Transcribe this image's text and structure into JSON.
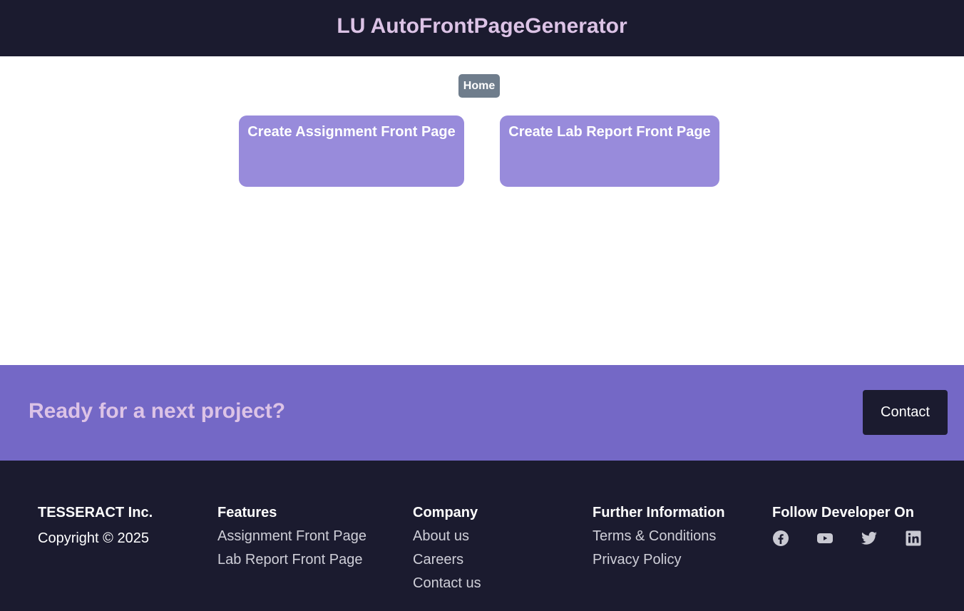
{
  "header": {
    "title": "LU AutoFrontPageGenerator"
  },
  "nav": {
    "home_label": "Home"
  },
  "cards": {
    "assignment": "Create Assignment Front Page",
    "lab_report": "Create Lab Report Front Page"
  },
  "cta": {
    "text": "Ready for a next project?",
    "button_label": "Contact"
  },
  "footer": {
    "brand": {
      "name": "TESSERACT Inc.",
      "copyright": "Copyright © 2025"
    },
    "features": {
      "heading": "Features",
      "links": [
        "Assignment Front Page",
        "Lab Report Front Page"
      ]
    },
    "company": {
      "heading": "Company",
      "links": [
        "About us",
        "Careers",
        "Contact us"
      ]
    },
    "further": {
      "heading": "Further Information",
      "links": [
        "Terms & Conditions",
        "Privacy Policy"
      ]
    },
    "social": {
      "heading": "Follow Developer On",
      "icons": [
        "facebook-icon",
        "youtube-icon",
        "twitter-icon",
        "linkedin-icon"
      ]
    }
  },
  "colors": {
    "dark": "#1b1b2f",
    "accent": "#7468c6",
    "card": "#988bdb",
    "title": "#dcc3e6",
    "home_button": "#6f7d8c"
  }
}
